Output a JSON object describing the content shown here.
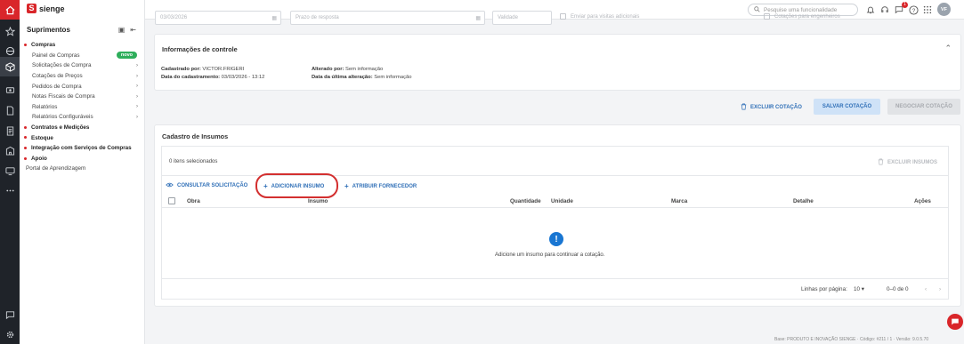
{
  "app": {
    "brand": "sienge",
    "logo_letter": "S"
  },
  "sidebar": {
    "title": "Suprimentos",
    "items": [
      {
        "label": "Compras",
        "type": "group"
      },
      {
        "label": "Painel de Compras",
        "type": "sub",
        "badge": "novo"
      },
      {
        "label": "Solicitações de Compra",
        "type": "sub",
        "arrow": true
      },
      {
        "label": "Cotações de Preços",
        "type": "sub",
        "arrow": true
      },
      {
        "label": "Pedidos de Compra",
        "type": "sub",
        "arrow": true
      },
      {
        "label": "Notas Fiscais de Compra",
        "type": "sub",
        "arrow": true
      },
      {
        "label": "Relatórios",
        "type": "sub",
        "arrow": true
      },
      {
        "label": "Relatórios Configuráveis",
        "type": "sub",
        "arrow": true
      },
      {
        "label": "Contratos e Medições",
        "type": "group"
      },
      {
        "label": "Estoque",
        "type": "group"
      },
      {
        "label": "Integração com Serviços de Compras",
        "type": "group"
      },
      {
        "label": "Apoio",
        "type": "group"
      },
      {
        "label": "Portal de Aprendizagem",
        "type": "plain"
      }
    ]
  },
  "topbar": {
    "search_placeholder": "Pesquise uma funcionalidade",
    "notification_count": "1",
    "avatar_initials": "VF"
  },
  "faded_form": {
    "date_value": "03/03/2026",
    "response_deadline_placeholder": "Prazo de resposta",
    "third_placeholder": "Validade",
    "check1_label": "Enviar para visitas adicionais",
    "check2_label": "Cotações para engenheiros"
  },
  "control_info": {
    "title": "Informações de controle",
    "created_by_label": "Cadastrado por:",
    "created_by_value": "VICTOR.FRIGERI",
    "created_date_label": "Data do cadastramento:",
    "created_date_value": "03/03/2026 - 13:12",
    "changed_by_label": "Alterado por:",
    "changed_by_value": "Sem informação",
    "changed_date_label": "Data da última alteração:",
    "changed_date_value": "Sem informação"
  },
  "actions": {
    "delete_quote": "EXCLUIR COTAÇÃO",
    "save_quote": "SALVAR COTAÇÃO",
    "negotiate_quote": "NEGOCIAR COTAÇÃO"
  },
  "insumos": {
    "title": "Cadastro de Insumos",
    "selected_count": "0 itens selecionados",
    "delete_insumos": "EXCLUIR INSUMOS",
    "consult_request": "CONSULTAR SOLICITAÇÃO",
    "add_insumo": "ADICIONAR INSUMO",
    "assign_supplier": "ATRIBUIR FORNECEDOR",
    "columns": [
      "Obra",
      "Insumo",
      "Quantidade",
      "Unidade",
      "Marca",
      "Detalhe",
      "Ações"
    ],
    "empty_message": "Adicione um insumo para continuar a cotação.",
    "rows_per_page_label": "Linhas por página:",
    "rows_per_page_value": "10",
    "range_label": "0–0 de 0"
  },
  "footer": {
    "text": "Base: PRODUTO E INOVAÇÃO SIENGE · Código: #211 / 1 · Versão: 9.0.5.70"
  },
  "colors": {
    "brand_red": "#d9262a",
    "link_blue": "#2f6fb7",
    "save_bg": "#cfe2f7",
    "rail_bg": "#1f2329",
    "novo_green": "#2eae5b",
    "highlight": "#d32f2f"
  }
}
